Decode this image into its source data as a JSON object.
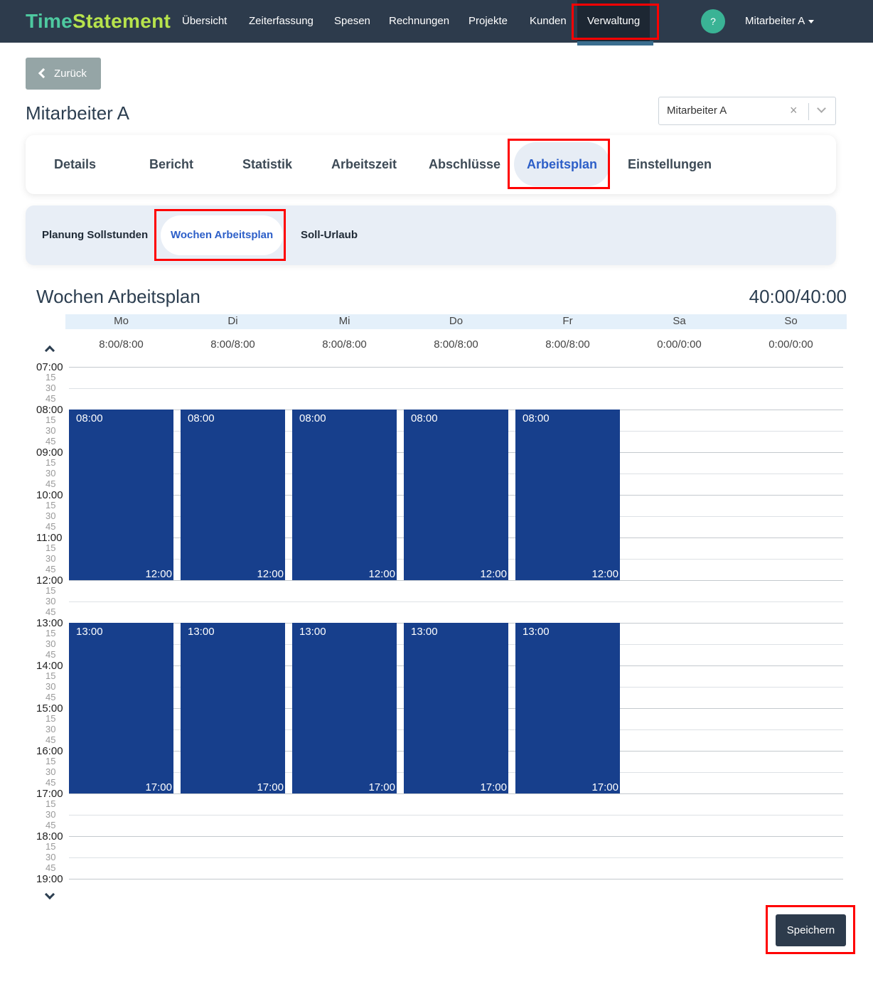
{
  "brand": {
    "part1": "Time",
    "part2": "Statement"
  },
  "nav": {
    "items": [
      "Übersicht",
      "Zeiterfassung",
      "Spesen",
      "Rechnungen",
      "Projekte",
      "Kunden",
      "Verwaltung"
    ],
    "active": "Verwaltung",
    "help": "?",
    "user": "Mitarbeiter A"
  },
  "back_label": "Zurück",
  "page_title": "Mitarbeiter A",
  "employee_select": {
    "value": "Mitarbeiter A",
    "clear": "×"
  },
  "main_tabs": [
    "Details",
    "Bericht",
    "Statistik",
    "Arbeitszeit",
    "Abschlüsse",
    "Arbeitsplan",
    "Einstellungen"
  ],
  "main_tab_active": "Arbeitsplan",
  "sub_tabs": [
    "Planung Sollstunden",
    "Wochen Arbeitsplan",
    "Soll-Urlaub"
  ],
  "sub_tab_active": "Wochen Arbeitsplan",
  "schedule": {
    "title": "Wochen Arbeitsplan",
    "total": "40:00/40:00",
    "days": [
      {
        "name": "Mo",
        "hours": "8:00/8:00"
      },
      {
        "name": "Di",
        "hours": "8:00/8:00"
      },
      {
        "name": "Mi",
        "hours": "8:00/8:00"
      },
      {
        "name": "Do",
        "hours": "8:00/8:00"
      },
      {
        "name": "Fr",
        "hours": "8:00/8:00"
      },
      {
        "name": "Sa",
        "hours": "0:00/0:00"
      },
      {
        "name": "So",
        "hours": "0:00/0:00"
      }
    ],
    "hours": [
      "07:00",
      "08:00",
      "09:00",
      "10:00",
      "11:00",
      "12:00",
      "13:00",
      "14:00",
      "15:00",
      "16:00",
      "17:00",
      "18:00",
      "19:00"
    ],
    "quarters": [
      "15",
      "30",
      "45"
    ],
    "blocks": [
      {
        "day": 0,
        "start": "08:00",
        "end": "12:00"
      },
      {
        "day": 1,
        "start": "08:00",
        "end": "12:00"
      },
      {
        "day": 2,
        "start": "08:00",
        "end": "12:00"
      },
      {
        "day": 3,
        "start": "08:00",
        "end": "12:00"
      },
      {
        "day": 4,
        "start": "08:00",
        "end": "12:00"
      },
      {
        "day": 0,
        "start": "13:00",
        "end": "17:00"
      },
      {
        "day": 1,
        "start": "13:00",
        "end": "17:00"
      },
      {
        "day": 2,
        "start": "13:00",
        "end": "17:00"
      },
      {
        "day": 3,
        "start": "13:00",
        "end": "17:00"
      },
      {
        "day": 4,
        "start": "13:00",
        "end": "17:00"
      }
    ]
  },
  "save_label": "Speichern",
  "colors": {
    "nav_bg": "#2d3b4c",
    "block": "#173f8c",
    "active_tab_text": "#2d5fc8",
    "highlight": "#ff0000"
  }
}
